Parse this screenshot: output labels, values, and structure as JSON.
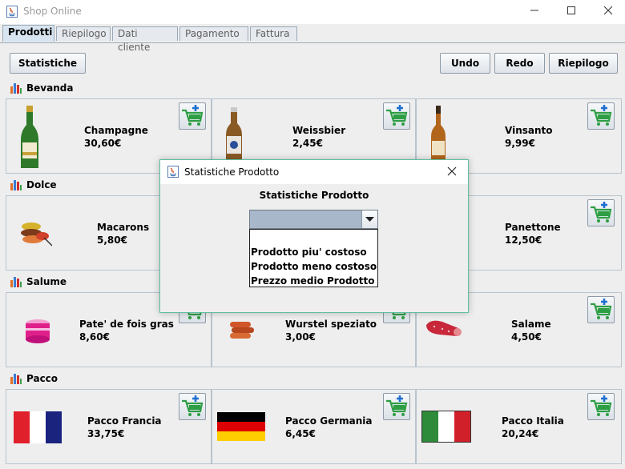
{
  "window": {
    "title": "Shop Online",
    "minimize": "—",
    "maximize": "☐",
    "close": "✕"
  },
  "tabs": [
    {
      "label": "Prodotti",
      "active": true
    },
    {
      "label": "Riepilogo",
      "active": false
    },
    {
      "label": "Dati cliente",
      "active": false
    },
    {
      "label": "Pagamento",
      "active": false
    },
    {
      "label": "Fattura",
      "active": false
    }
  ],
  "toolbar": {
    "statistiche": "Statistiche",
    "undo": "Undo",
    "redo": "Redo",
    "riepilogo": "Riepilogo"
  },
  "categories": [
    {
      "name": "Bevanda",
      "products": [
        {
          "name": "Champagne",
          "price": "30,60€",
          "image": "champagne-bottle"
        },
        {
          "name": "Weissbier",
          "price": "2,45€",
          "image": "beer-bottle"
        },
        {
          "name": "Vinsanto",
          "price": "9,99€",
          "image": "wine-bottle"
        }
      ]
    },
    {
      "name": "Dolce",
      "products": [
        {
          "name": "Macarons",
          "price": "5,80€",
          "image": "macarons"
        },
        {
          "name": "",
          "price": "",
          "image": ""
        },
        {
          "name": "Panettone",
          "price": "12,50€",
          "image": ""
        }
      ]
    },
    {
      "name": "Salume",
      "products": [
        {
          "name": "Pate' de fois gras",
          "price": "8,60€",
          "image": "pate-jar"
        },
        {
          "name": "Wurstel speziato",
          "price": "3,00€",
          "image": "wurstel"
        },
        {
          "name": "Salame",
          "price": "4,50€",
          "image": "salame"
        }
      ]
    },
    {
      "name": "Pacco",
      "products": [
        {
          "name": "Pacco Francia",
          "price": "33,75€",
          "image": "flag-france"
        },
        {
          "name": "Pacco Germania",
          "price": "6,45€",
          "image": "flag-germany"
        },
        {
          "name": "Pacco Italia",
          "price": "20,24€",
          "image": "flag-italy"
        }
      ]
    }
  ],
  "dialog": {
    "title": "Statistiche Prodotto",
    "close": "✕",
    "heading": "Statistiche Prodotto",
    "combo_selected": "",
    "options": [
      "Prodotto piu' costoso",
      "Prodotto meno costoso",
      "Prezzo medio Prodotto"
    ]
  },
  "colors": {
    "cart_green": "#2e9e44",
    "cart_plus_blue": "#1e6fd0",
    "dialog_border": "#5dbfa0",
    "combo_fill": "#a8b7c9"
  }
}
